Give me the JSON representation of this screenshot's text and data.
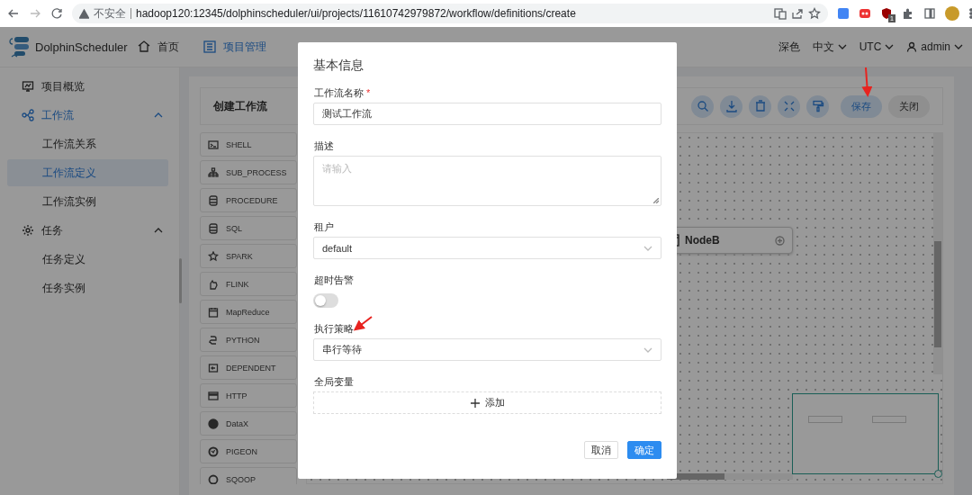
{
  "browser": {
    "security_label": "不安全",
    "url": "hadoop120:12345/dolphinscheduler/ui/projects/11610742979872/workflow/definitions/create",
    "extension_badge": "1"
  },
  "header": {
    "logo": "DolphinScheduler",
    "nav": [
      {
        "label": "首页",
        "selected": false
      },
      {
        "label": "项目管理",
        "selected": true
      }
    ],
    "theme": "深色",
    "language": "中文",
    "timezone": "UTC",
    "user": "admin"
  },
  "sidebar": {
    "items": [
      {
        "label": "项目概览",
        "selected": false
      },
      {
        "label": "工作流",
        "selected": false,
        "expanded": true,
        "children": [
          {
            "label": "工作流关系",
            "selected": false
          },
          {
            "label": "工作流定义",
            "selected": true
          },
          {
            "label": "工作流实例",
            "selected": false
          }
        ]
      },
      {
        "label": "任务",
        "selected": false,
        "expanded": true,
        "children": [
          {
            "label": "任务定义",
            "selected": false
          },
          {
            "label": "任务实例",
            "selected": false
          }
        ]
      }
    ]
  },
  "workspace": {
    "title": "创建工作流",
    "save": "保存",
    "close": "关闭",
    "tasks": [
      "SHELL",
      "SUB_PROCESS",
      "PROCEDURE",
      "SQL",
      "SPARK",
      "FLINK",
      "MapReduce",
      "PYTHON",
      "DEPENDENT",
      "HTTP",
      "DataX",
      "PIGEON",
      "SQOOP"
    ],
    "nodes": [
      {
        "label": "NodeB"
      }
    ]
  },
  "modal": {
    "title": "基本信息",
    "fields": [
      {
        "kind": "text",
        "label": "工作流名称",
        "required_mark": "*",
        "value": "测试工作流"
      },
      {
        "kind": "textarea",
        "label": "描述",
        "placeholder": "请输入"
      },
      {
        "kind": "select",
        "label": "租户",
        "value": "default"
      },
      {
        "kind": "switch",
        "label": "超时告警",
        "on": false
      },
      {
        "kind": "select",
        "label": "执行策略",
        "value": "串行等待"
      },
      {
        "kind": "add",
        "label": "全局变量",
        "button": "添加"
      }
    ],
    "buttons": [
      {
        "label": "取消",
        "kind": "default"
      },
      {
        "label": "确定",
        "kind": "primary"
      }
    ]
  }
}
